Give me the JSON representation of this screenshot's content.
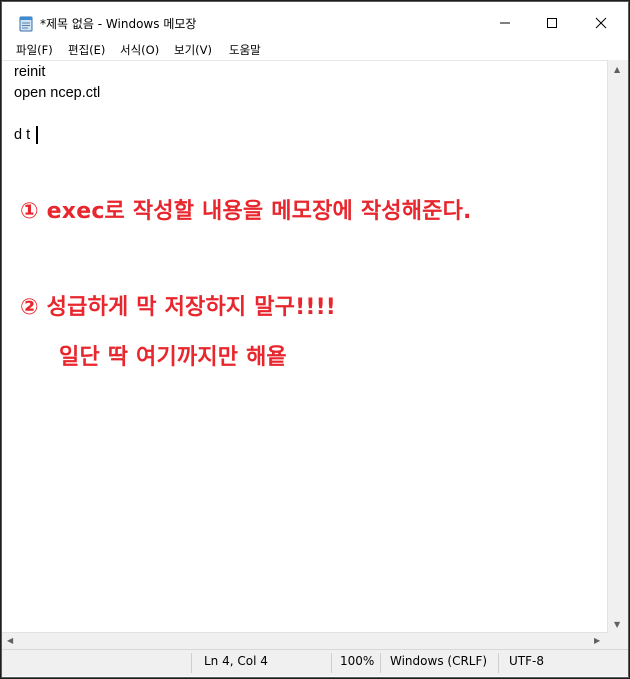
{
  "window": {
    "title": "*제목 없음 - Windows 메모장",
    "icon": "notepad-icon",
    "controls": [
      "minimize-icon",
      "maximize-icon",
      "close-icon"
    ]
  },
  "menu": {
    "items": [
      {
        "label": "파일(F)"
      },
      {
        "label": "편집(E)"
      },
      {
        "label": "서식(O)"
      },
      {
        "label": "보기(V)"
      },
      {
        "label": "도움말"
      }
    ]
  },
  "editor": {
    "lines": [
      "reinit",
      "open ncep.ctl",
      "",
      "d t"
    ]
  },
  "annotation": {
    "color": "#e8262d",
    "step1": "① exec로 작성할 내용을 메모장에 작성해준다.",
    "step2_line1": "② 성급하게 막 저장하지 말구!!!!",
    "step2_line2": "일단 딱 여기까지만 해욭"
  },
  "status": {
    "position": "Ln 4, Col 4",
    "zoom": "100%",
    "line_ending": "Windows (CRLF)",
    "encoding": "UTF-8"
  }
}
